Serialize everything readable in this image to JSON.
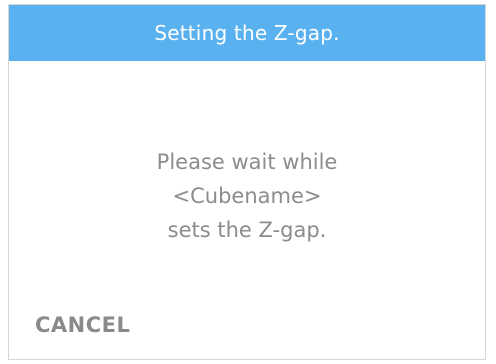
{
  "dialog": {
    "title": "Setting the Z-gap.",
    "message_lines": [
      "Please wait while",
      "<Cubename>",
      "sets the Z-gap."
    ],
    "cancel_label": "CANCEL"
  },
  "colors": {
    "header_bg": "#5ab1ef",
    "header_text": "#ffffff",
    "body_text": "#8c8c8c",
    "button_text": "#8a8a8a"
  }
}
